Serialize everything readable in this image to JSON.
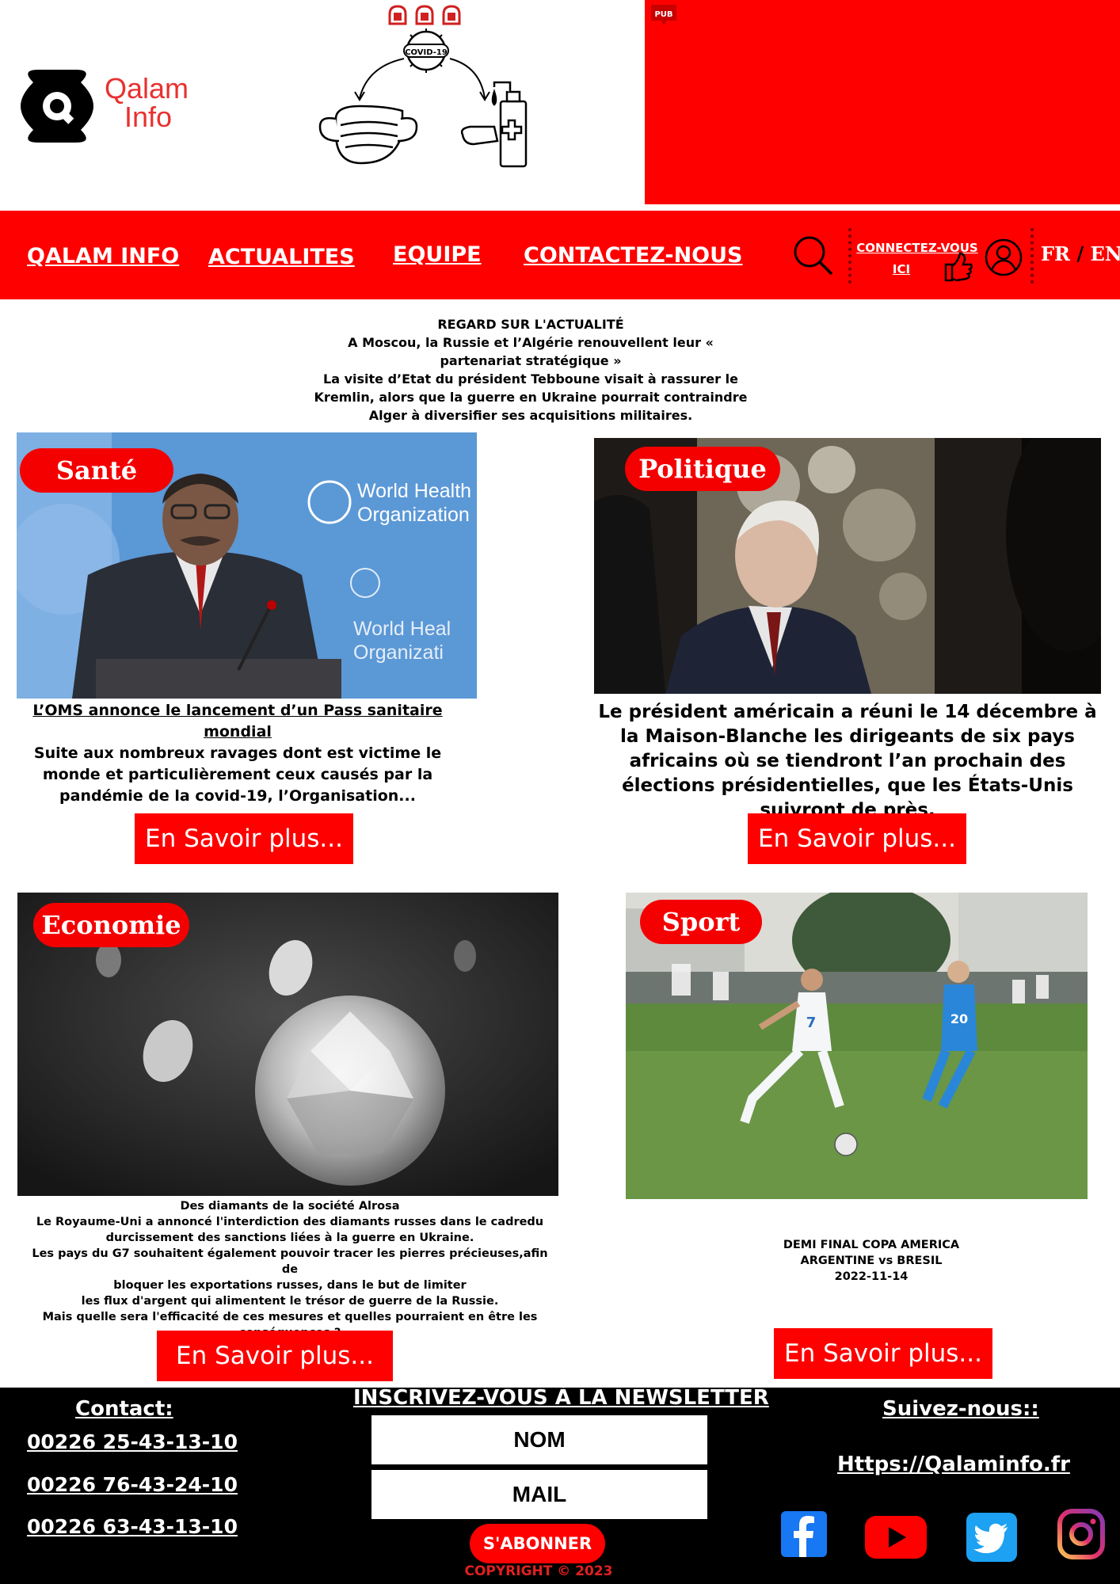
{
  "brand": {
    "logo_line1": "Qalam",
    "logo_line2": "Info",
    "accent": "#fe0000"
  },
  "header": {
    "covid_label": "COVID-19",
    "pub_label": "PUB"
  },
  "nav": {
    "items": [
      "QALAM INFO",
      "ACTUALITES",
      "EQUIPE",
      "CONTACTEZ-NOUS"
    ],
    "connect_line1": "CONNECTEZ-VOUS",
    "connect_line2": "ICI",
    "lang_fr": "FR",
    "lang_sep": "/",
    "lang_en": "EN",
    "icons": [
      "search-icon",
      "thumbs-up-icon",
      "user-icon"
    ]
  },
  "headline": {
    "kicker": "REGARD SUR L'ACTUALITÉ",
    "title": "A Moscou, la Russie et l’Algérie renouvellent leur « partenariat stratégique »",
    "summary": "La visite d’Etat du président Tebboune visait à rassurer le Kremlin, alors que la guerre en Ukraine pourrait contraindre Alger à diversifier ses acquisitions militaires."
  },
  "cards": {
    "sante": {
      "badge": "Santé",
      "title": "L’OMS annonce le lancement d’un Pass sanitaire mondial",
      "text": "Suite aux nombreux ravages dont est victime le monde et particulièrement ceux causés par la pandémie de la covid-19, l’Organisation...",
      "photo_text_1": "World Health",
      "photo_text_2": "Organization",
      "photo_text_3": "World Heal",
      "photo_text_4": "Organizati",
      "button": "En Savoir plus..."
    },
    "politique": {
      "badge": "Politique",
      "text": "Le président américain a réuni le 14 décembre à la Maison-Blanche les dirigeants de six pays africains où se tiendront l’an prochain des élections présidentielles, que les États-Unis suivront de près.",
      "button": "En Savoir plus..."
    },
    "economie": {
      "badge": "Economie",
      "line1": "Des diamants de la société Alrosa",
      "line2": "Le Royaume-Uni a annoncé l'interdiction des diamants russes dans le cadredu",
      "line3": "durcissement des sanctions liées à la guerre en Ukraine.",
      "line4": "Les pays du G7 souhaitent également pouvoir tracer les pierres précieuses,afin de",
      "line5": "bloquer les exportations russes, dans le but de limiter",
      "line6": "les flux d'argent qui alimentent le trésor de guerre de la Russie.",
      "line7": "Mais quelle sera l'efficacité de ces mesures et quelles pourraient en être les",
      "line8": "conséquences ?",
      "button": "En Savoir plus..."
    },
    "sport": {
      "badge": "Sport",
      "line1": "DEMI FINAL COPA AMERICA",
      "line2": "ARGENTINE vs BRESIL",
      "line3": "2022-11-14",
      "jersey_1": "7",
      "jersey_2": "20",
      "button": "En Savoir plus..."
    }
  },
  "footer": {
    "contact_title": "Contact:",
    "phones": [
      "00226 25-43-13-10",
      "00226 76-43-24-10",
      "00226 63-43-13-10"
    ],
    "newsletter_title": "INSCRIVEZ-VOUS À LA NEWSLETTER",
    "name_field": "NOM",
    "mail_field": "MAIL",
    "subscribe": "S'ABONNER",
    "copyright": "COPYRIGHT © 2023",
    "follow_title": "Suivez-nous::",
    "site": "Https://Qalaminfo.fr",
    "social": [
      "facebook-icon",
      "youtube-icon",
      "twitter-icon",
      "instagram-icon"
    ]
  }
}
